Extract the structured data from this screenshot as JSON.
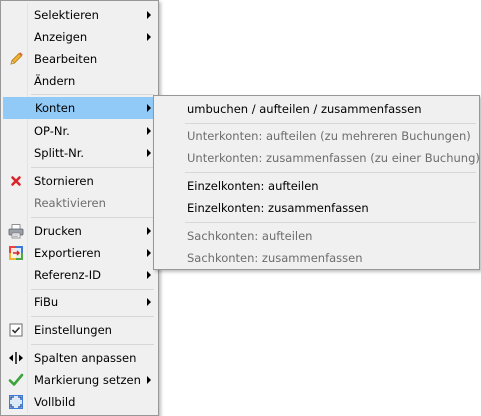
{
  "main_menu": {
    "items": [
      {
        "label": "Selektieren",
        "submenu": true
      },
      {
        "label": "Anzeigen",
        "submenu": true
      },
      {
        "label": "Bearbeiten",
        "icon": "pencil-icon"
      },
      {
        "label": "Ändern"
      },
      {
        "label": "Konten",
        "submenu": true,
        "highlighted": true
      },
      {
        "label": "OP-Nr.",
        "submenu": true
      },
      {
        "label": "Splitt-Nr.",
        "submenu": true
      },
      {
        "label": "Stornieren",
        "icon": "red-x-icon"
      },
      {
        "label": "Reaktivieren",
        "disabled": true
      },
      {
        "label": "Drucken",
        "icon": "printer-icon",
        "submenu": true
      },
      {
        "label": "Exportieren",
        "icon": "export-icon",
        "submenu": true
      },
      {
        "label": "Referenz-ID",
        "submenu": true
      },
      {
        "label": "FiBu",
        "submenu": true
      },
      {
        "label": "Einstellungen",
        "icon": "checkbox-checked-icon"
      },
      {
        "label": "Spalten anpassen",
        "icon": "column-resize-icon"
      },
      {
        "label": "Markierung setzen",
        "icon": "checkmark-icon",
        "submenu": true
      },
      {
        "label": "Vollbild",
        "icon": "fullscreen-icon"
      }
    ]
  },
  "sub_menu": {
    "items": [
      {
        "label": "umbuchen / aufteilen / zusammenfassen"
      },
      {
        "label": "Unterkonten: aufteilen (zu mehreren Buchungen)",
        "disabled": true
      },
      {
        "label": "Unterkonten: zusammenfassen (zu einer Buchung)",
        "disabled": true
      },
      {
        "label": "Einzelkonten: aufteilen"
      },
      {
        "label": "Einzelkonten: zusammenfassen"
      },
      {
        "label": "Sachkonten: aufteilen",
        "disabled": true
      },
      {
        "label": "Sachkonten: zusammenfassen",
        "disabled": true
      }
    ]
  },
  "colors": {
    "highlight": "#91c9f7",
    "menu_background": "#f0f0f0",
    "disabled_text": "#6d6d6d"
  }
}
